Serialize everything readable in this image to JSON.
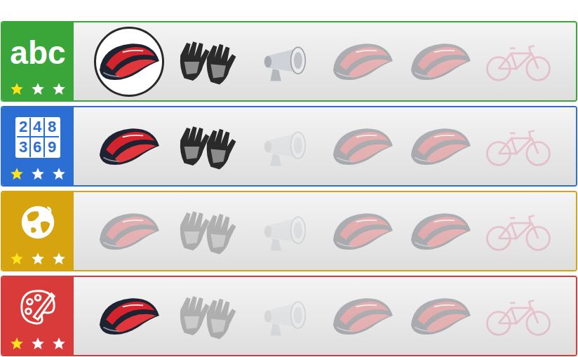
{
  "categories": [
    {
      "kind": "letters",
      "label": "abc",
      "color": "#3aa63a",
      "stars": 1,
      "items": [
        {
          "kind": "helmet",
          "unlocked": true,
          "selected": true
        },
        {
          "kind": "gloves",
          "unlocked": true,
          "selected": false
        },
        {
          "kind": "lamp",
          "unlocked": true,
          "selected": false
        },
        {
          "kind": "helmet",
          "unlocked": false,
          "selected": false
        },
        {
          "kind": "helmet",
          "unlocked": false,
          "selected": false
        },
        {
          "kind": "bike",
          "unlocked": false,
          "selected": false
        }
      ]
    },
    {
      "kind": "numbers",
      "digits": [
        "2",
        "4",
        "8",
        "3",
        "6",
        "9"
      ],
      "color": "#2b6fd4",
      "stars": 1,
      "items": [
        {
          "kind": "helmet",
          "unlocked": true,
          "selected": false
        },
        {
          "kind": "gloves",
          "unlocked": true,
          "selected": false
        },
        {
          "kind": "lamp",
          "unlocked": false,
          "selected": false
        },
        {
          "kind": "helmet",
          "unlocked": false,
          "selected": false
        },
        {
          "kind": "helmet",
          "unlocked": false,
          "selected": false
        },
        {
          "kind": "bike",
          "unlocked": false,
          "selected": false
        }
      ]
    },
    {
      "kind": "globe",
      "color": "#d6a40e",
      "stars": 1,
      "items": [
        {
          "kind": "helmet",
          "unlocked": false,
          "selected": false
        },
        {
          "kind": "gloves",
          "unlocked": false,
          "selected": false
        },
        {
          "kind": "lamp",
          "unlocked": false,
          "selected": false
        },
        {
          "kind": "helmet",
          "unlocked": false,
          "selected": false
        },
        {
          "kind": "helmet",
          "unlocked": false,
          "selected": false
        },
        {
          "kind": "bike",
          "unlocked": false,
          "selected": false
        }
      ]
    },
    {
      "kind": "palette",
      "color": "#d93a3a",
      "stars": 1,
      "items": [
        {
          "kind": "helmet",
          "unlocked": true,
          "selected": false
        },
        {
          "kind": "gloves",
          "unlocked": false,
          "selected": false
        },
        {
          "kind": "lamp",
          "unlocked": false,
          "selected": false
        },
        {
          "kind": "helmet",
          "unlocked": false,
          "selected": false
        },
        {
          "kind": "helmet",
          "unlocked": false,
          "selected": false
        },
        {
          "kind": "bike",
          "unlocked": false,
          "selected": false
        }
      ]
    }
  ]
}
